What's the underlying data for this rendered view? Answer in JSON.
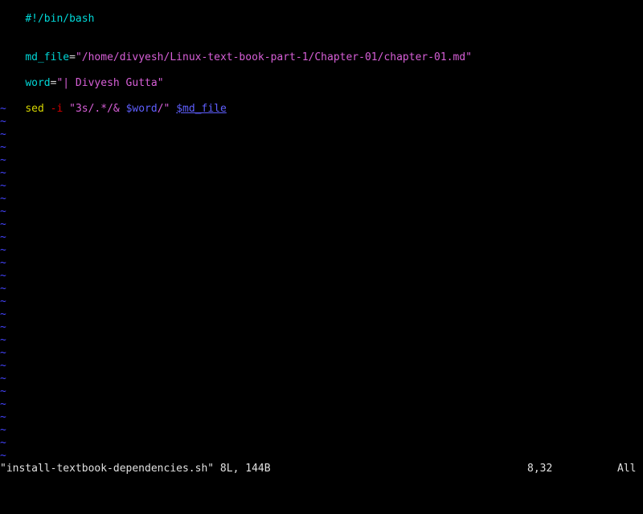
{
  "editor": {
    "lines": [
      {
        "shebang": "#!/bin/bash"
      },
      {},
      {},
      {
        "var": "md_file",
        "op": "=",
        "q1": "\"",
        "value": "/home/divyesh/Linux-text-book-part-1/Chapter-01/chapter-01.md",
        "q2": "\""
      },
      {},
      {
        "var": "word",
        "op": "=",
        "q1": "\"",
        "value": "| Divyesh Gutta",
        "q2": "\""
      },
      {},
      {
        "cmd": "sed",
        "flag": "-i",
        "q1": "\"",
        "sexpr": "3s/.*/& ",
        "ref": "$word",
        "slash": "/",
        "q2": "\"",
        "arg_ref_prefix": "$md_fil",
        "arg_ref_cursor": "e"
      }
    ],
    "tilde": "~",
    "tilde_count": 28
  },
  "status": {
    "file": "\"install-textbook-dependencies.sh\" 8L, 144B",
    "position": "8,32",
    "scroll": "All"
  },
  "colors": {
    "background": "#000000",
    "tilde": "#4444ff",
    "string": "#d75fd7",
    "identifier": "#00d7d7",
    "statement": "#d7d700",
    "flag": "#d70000",
    "variable_ref": "#5f5fff"
  }
}
